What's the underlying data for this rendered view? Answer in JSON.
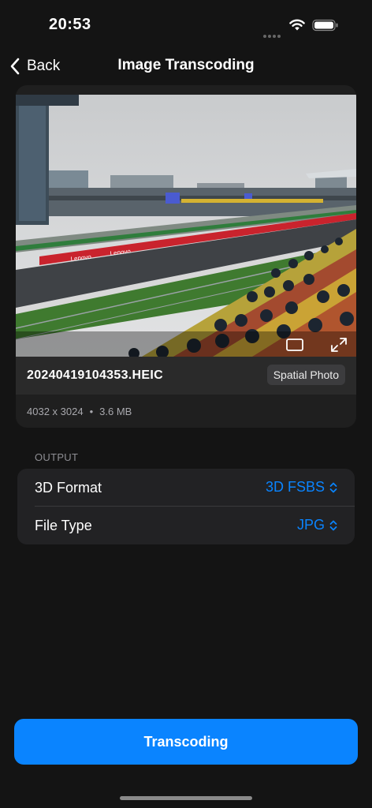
{
  "status_bar": {
    "time": "20:53",
    "wifi_icon": "wifi-icon",
    "battery_icon": "battery-icon"
  },
  "nav": {
    "back_label": "Back",
    "title": "Image Transcoding",
    "back_icon": "chevron-left-icon"
  },
  "media": {
    "file_name": "20240419104353.HEIC",
    "badge": "Spatial Photo",
    "resolution": "4032 x 3024",
    "separator": "•",
    "size": "3.6 MB",
    "overlay_icons": [
      "rectangle-icon",
      "expand-icon"
    ],
    "photo_sign_text": "Lenovo"
  },
  "output": {
    "section_label": "OUTPUT",
    "rows": [
      {
        "label": "3D Format",
        "value": "3D FSBS"
      },
      {
        "label": "File Type",
        "value": "JPG"
      }
    ]
  },
  "action": {
    "label": "Transcoding"
  },
  "colors": {
    "accent": "#0a84ff",
    "background": "#141414",
    "card": "#1f1f1f",
    "group": "#222224"
  }
}
